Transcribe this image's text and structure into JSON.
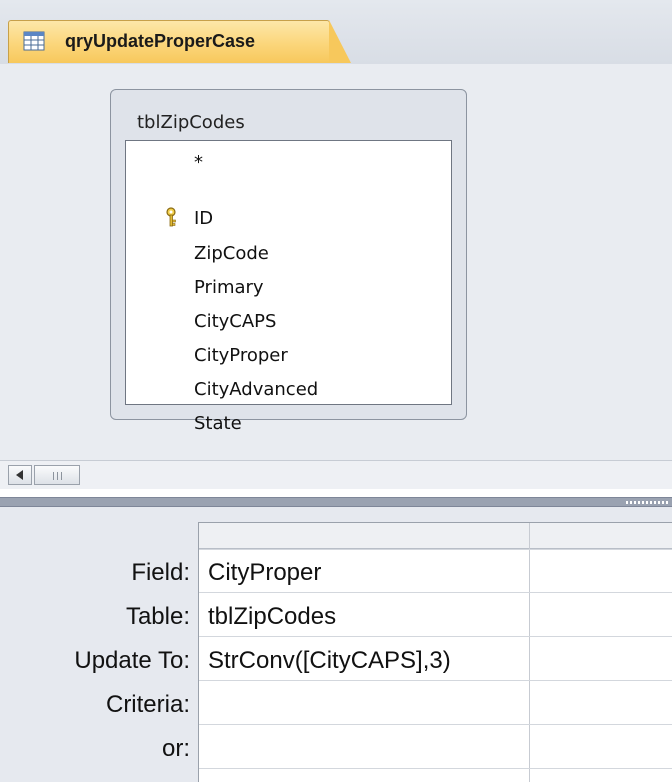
{
  "tab": {
    "label": "qryUpdateProperCase",
    "icon": "query-icon"
  },
  "table": {
    "name": "tblZipCodes",
    "fields": [
      "*",
      "ID",
      "ZipCode",
      "Primary",
      "CityCAPS",
      "CityProper",
      "CityAdvanced",
      "State"
    ],
    "key_field": "ID"
  },
  "grid": {
    "row_labels": {
      "field": "Field:",
      "table": "Table:",
      "update_to": "Update To:",
      "criteria": "Criteria:",
      "or": "or:"
    },
    "column1": {
      "field": "CityProper",
      "table": "tblZipCodes",
      "update_to": "StrConv([CityCAPS],3)",
      "criteria": "",
      "or": ""
    }
  },
  "colors": {
    "tab_active": "#fbd67b",
    "pane_background": "#e9ecf1",
    "splitter": "#9aa2b1"
  }
}
